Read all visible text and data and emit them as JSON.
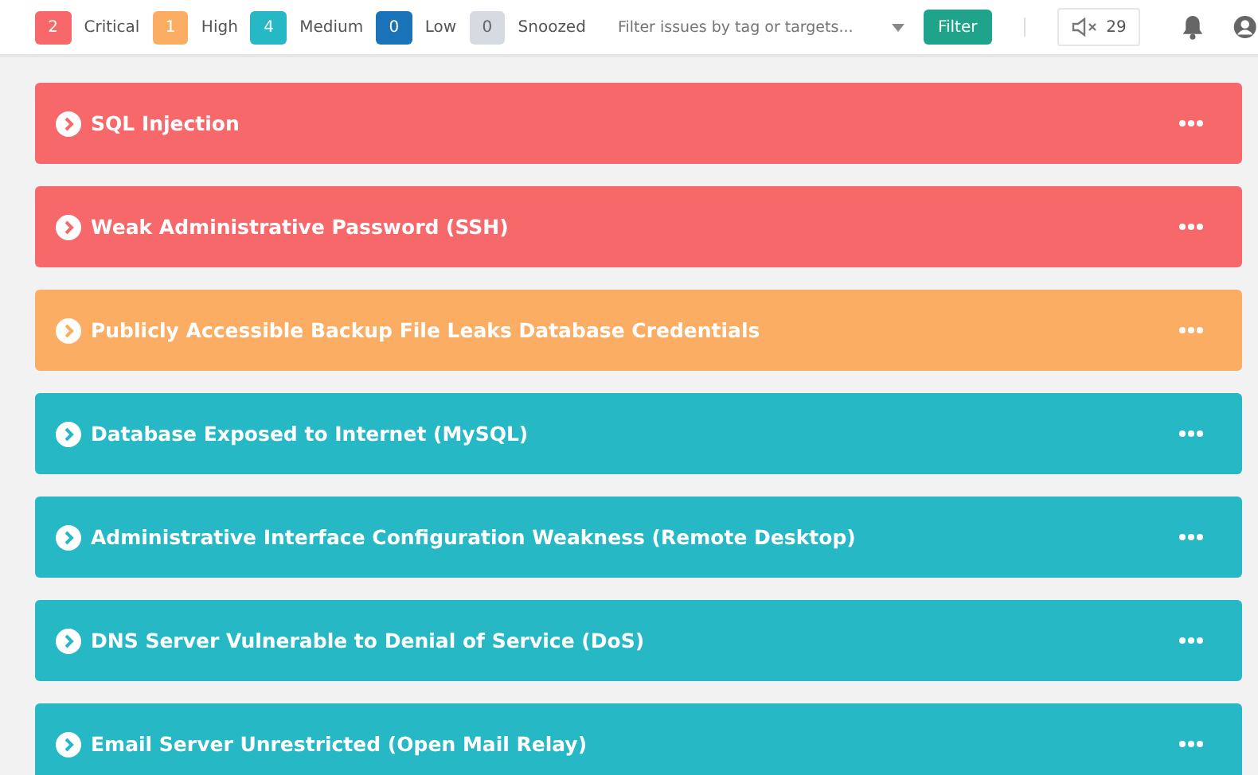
{
  "counters": [
    {
      "color": "#f7686b",
      "count": "2",
      "label": "Critical"
    },
    {
      "color": "#fbae63",
      "count": "1",
      "label": "High"
    },
    {
      "color": "#27b8c6",
      "count": "4",
      "label": "Medium"
    },
    {
      "color": "#1a73b8",
      "count": "0",
      "label": "Low"
    },
    {
      "color": "#d5dbe0",
      "count": "0",
      "label": "Snoozed"
    }
  ],
  "search": {
    "placeholder": "Filter issues by tag or targets..."
  },
  "filter_button": "Filter",
  "muted_count": "29",
  "issues": [
    {
      "color": "#f7686b",
      "title": "SQL Injection"
    },
    {
      "color": "#f7686b",
      "title": "Weak Administrative Password (SSH)"
    },
    {
      "color": "#fbae63",
      "title": "Publicly Accessible Backup File Leaks Database Credentials"
    },
    {
      "color": "#27b8c6",
      "title": "Database Exposed to Internet (MySQL)"
    },
    {
      "color": "#27b8c6",
      "title": "Administrative Interface Configuration Weakness (Remote Desktop)"
    },
    {
      "color": "#27b8c6",
      "title": "DNS Server Vulnerable to Denial of Service (DoS)"
    },
    {
      "color": "#27b8c6",
      "title": "Email Server Unrestricted (Open Mail Relay)"
    }
  ]
}
